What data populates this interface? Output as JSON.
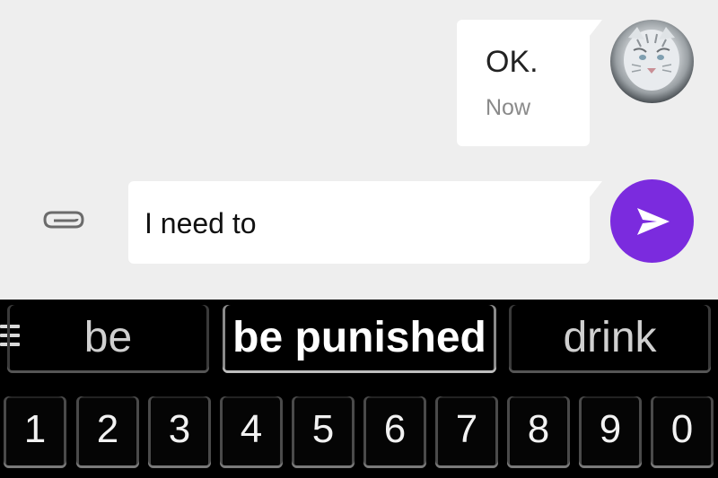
{
  "chat": {
    "message": {
      "text": "OK.",
      "time": "Now"
    },
    "compose": {
      "text": "I need to"
    }
  },
  "keyboard": {
    "suggestions": [
      "be",
      "be punished",
      "drink"
    ],
    "number_row": [
      "1",
      "2",
      "3",
      "4",
      "5",
      "6",
      "7",
      "8",
      "9",
      "0"
    ]
  },
  "colors": {
    "send_button": "#7b2bde",
    "bubble": "#ffffff",
    "chat_bg": "#eeeeee"
  },
  "icons": [
    "avatar-image",
    "paperclip-icon",
    "send-icon",
    "menu-icon"
  ]
}
